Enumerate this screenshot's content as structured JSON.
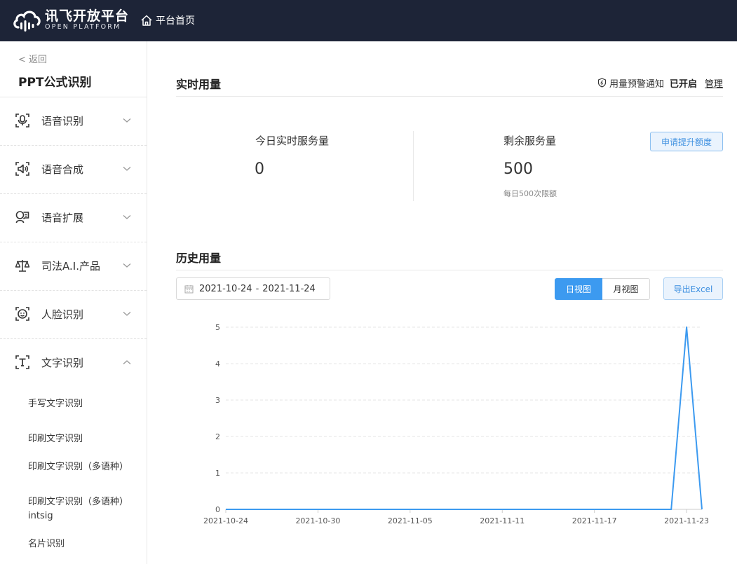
{
  "topbar": {
    "logo_cn": "讯飞开放平台",
    "logo_en": "OPEN PLATFORM",
    "home_label": "平台首页",
    "bg_color": "#1d2437"
  },
  "sidebar": {
    "back_label": "< 返回",
    "product_title": "PPT公式识别",
    "items": [
      {
        "label": "语音识别",
        "icon": "mic-box-icon",
        "expanded": false
      },
      {
        "label": "语音合成",
        "icon": "speaker-icon",
        "expanded": false
      },
      {
        "label": "语音扩展",
        "icon": "voice-person-icon",
        "expanded": false
      },
      {
        "label": "司法A.I.产品",
        "icon": "scales-icon",
        "expanded": false
      },
      {
        "label": "人脸识别",
        "icon": "face-icon",
        "expanded": false
      },
      {
        "label": "文字识别",
        "icon": "text-t-icon",
        "expanded": true
      }
    ],
    "sub_items": [
      "手写文字识别",
      "印刷文字识别",
      "印刷文字识别（多语种）",
      "印刷文字识别（多语种） intsig",
      "名片识别"
    ]
  },
  "realtime": {
    "title": "实时用量",
    "alert_label": "用量预警通知",
    "alert_status": "已开启",
    "manage_label": "管理",
    "today_label": "今日实时服务量",
    "today_value": "0",
    "remaining_label": "剩余服务量",
    "remaining_value": "500",
    "remaining_note": "每日500次限额",
    "raise_button": "申请提升额度"
  },
  "history": {
    "title": "历史用量",
    "date_start": "2021-10-24",
    "date_sep": "-",
    "date_end": "2021-11-24",
    "view_day": "日视图",
    "view_month": "月视图",
    "export_label": "导出Excel",
    "accent_color": "#3c9af0"
  },
  "chart_data": {
    "type": "line",
    "x_ticks": [
      "2021-10-24",
      "2021-10-30",
      "2021-11-05",
      "2021-11-11",
      "2021-11-17",
      "2021-11-23"
    ],
    "y_ticks": [
      0,
      1,
      2,
      3,
      4,
      5
    ],
    "ylim": [
      0,
      5
    ],
    "x_start": "2021-10-24",
    "x_end": "2021-11-24",
    "grid": true,
    "series": [
      {
        "color": "#3c9af0",
        "points": [
          [
            "2021-10-24",
            0
          ],
          [
            "2021-10-25",
            0
          ],
          [
            "2021-10-26",
            0
          ],
          [
            "2021-10-27",
            0
          ],
          [
            "2021-10-28",
            0
          ],
          [
            "2021-10-29",
            0
          ],
          [
            "2021-10-30",
            0
          ],
          [
            "2021-10-31",
            0
          ],
          [
            "2021-11-01",
            0
          ],
          [
            "2021-11-02",
            0
          ],
          [
            "2021-11-03",
            0
          ],
          [
            "2021-11-04",
            0
          ],
          [
            "2021-11-05",
            0
          ],
          [
            "2021-11-06",
            0
          ],
          [
            "2021-11-07",
            0
          ],
          [
            "2021-11-08",
            0
          ],
          [
            "2021-11-09",
            0
          ],
          [
            "2021-11-10",
            0
          ],
          [
            "2021-11-11",
            0
          ],
          [
            "2021-11-12",
            0
          ],
          [
            "2021-11-13",
            0
          ],
          [
            "2021-11-14",
            0
          ],
          [
            "2021-11-15",
            0
          ],
          [
            "2021-11-16",
            0
          ],
          [
            "2021-11-17",
            0
          ],
          [
            "2021-11-18",
            0
          ],
          [
            "2021-11-19",
            0
          ],
          [
            "2021-11-20",
            0
          ],
          [
            "2021-11-21",
            0
          ],
          [
            "2021-11-22",
            0
          ],
          [
            "2021-11-23",
            5
          ],
          [
            "2021-11-24",
            0
          ]
        ]
      }
    ]
  }
}
